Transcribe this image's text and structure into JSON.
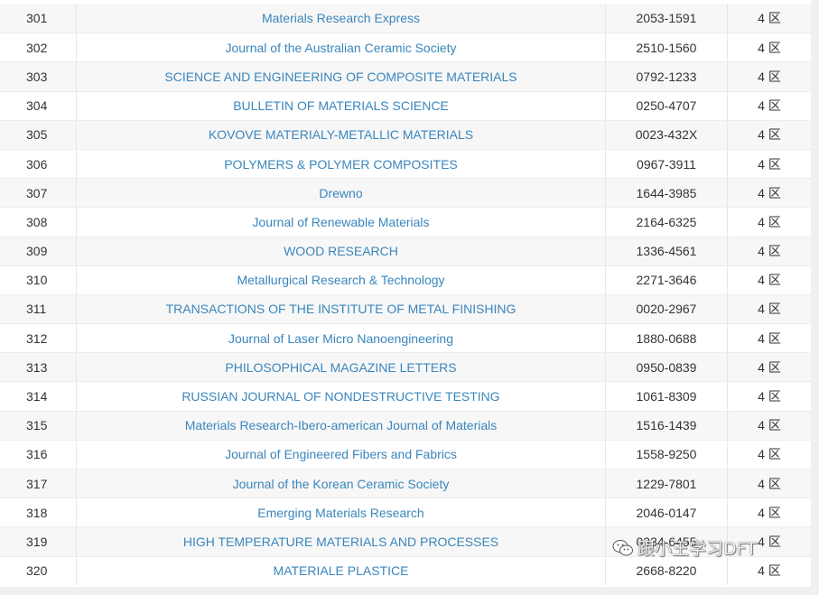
{
  "journals": [
    {
      "no": "301",
      "name": "Materials Research Express",
      "issn": "2053-1591",
      "zone": "4 区"
    },
    {
      "no": "302",
      "name": "Journal of the Australian Ceramic Society",
      "issn": "2510-1560",
      "zone": "4 区"
    },
    {
      "no": "303",
      "name": "SCIENCE AND ENGINEERING OF COMPOSITE MATERIALS",
      "issn": "0792-1233",
      "zone": "4 区"
    },
    {
      "no": "304",
      "name": "BULLETIN OF MATERIALS SCIENCE",
      "issn": "0250-4707",
      "zone": "4 区"
    },
    {
      "no": "305",
      "name": "KOVOVE MATERIALY-METALLIC MATERIALS",
      "issn": "0023-432X",
      "zone": "4 区"
    },
    {
      "no": "306",
      "name": "POLYMERS & POLYMER COMPOSITES",
      "issn": "0967-3911",
      "zone": "4 区"
    },
    {
      "no": "307",
      "name": "Drewno",
      "issn": "1644-3985",
      "zone": "4 区"
    },
    {
      "no": "308",
      "name": "Journal of Renewable Materials",
      "issn": "2164-6325",
      "zone": "4 区"
    },
    {
      "no": "309",
      "name": "WOOD RESEARCH",
      "issn": "1336-4561",
      "zone": "4 区"
    },
    {
      "no": "310",
      "name": "Metallurgical Research & Technology",
      "issn": "2271-3646",
      "zone": "4 区"
    },
    {
      "no": "311",
      "name": "TRANSACTIONS OF THE INSTITUTE OF METAL FINISHING",
      "issn": "0020-2967",
      "zone": "4 区"
    },
    {
      "no": "312",
      "name": "Journal of Laser Micro Nanoengineering",
      "issn": "1880-0688",
      "zone": "4 区"
    },
    {
      "no": "313",
      "name": "PHILOSOPHICAL MAGAZINE LETTERS",
      "issn": "0950-0839",
      "zone": "4 区"
    },
    {
      "no": "314",
      "name": "RUSSIAN JOURNAL OF NONDESTRUCTIVE TESTING",
      "issn": "1061-8309",
      "zone": "4 区"
    },
    {
      "no": "315",
      "name": "Materials Research-Ibero-american Journal of Materials",
      "issn": "1516-1439",
      "zone": "4 区"
    },
    {
      "no": "316",
      "name": "Journal of Engineered Fibers and Fabrics",
      "issn": "1558-9250",
      "zone": "4 区"
    },
    {
      "no": "317",
      "name": "Journal of the Korean Ceramic Society",
      "issn": "1229-7801",
      "zone": "4 区"
    },
    {
      "no": "318",
      "name": "Emerging Materials Research",
      "issn": "2046-0147",
      "zone": "4 区"
    },
    {
      "no": "319",
      "name": "HIGH TEMPERATURE MATERIALS AND PROCESSES",
      "issn": "0334-6455",
      "zone": "4 区"
    },
    {
      "no": "320",
      "name": "MATERIALE PLASTICE",
      "issn": "2668-8220",
      "zone": "4 区"
    }
  ],
  "watermark": {
    "text": "跟小王学习DFT",
    "icon": "wechat-icon"
  },
  "colors": {
    "link": "#3a86bc",
    "row_alt": "#f7f7f7",
    "text": "#333333"
  }
}
